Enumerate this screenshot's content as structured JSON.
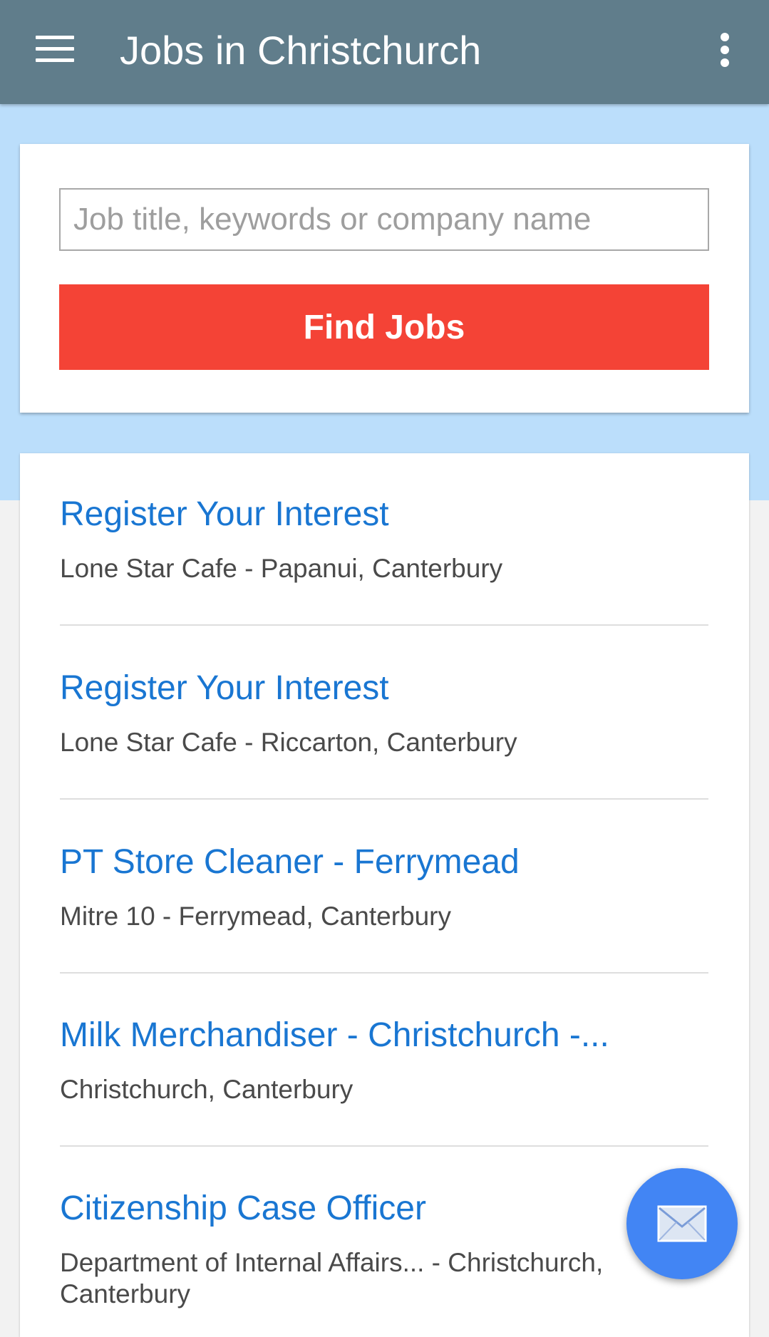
{
  "app_bar": {
    "title": "Jobs in Christchurch",
    "menu_icon": "hamburger-menu-icon",
    "overflow_icon": "more-vert-icon"
  },
  "search": {
    "placeholder": "Job title, keywords or company name",
    "value": "",
    "button_label": "Find Jobs"
  },
  "jobs": [
    {
      "title": "Register Your Interest",
      "meta": "Lone Star Cafe - Papanui, Canterbury"
    },
    {
      "title": "Register Your Interest",
      "meta": "Lone Star Cafe - Riccarton, Canterbury"
    },
    {
      "title": "PT Store Cleaner - Ferrymead",
      "meta": "Mitre 10 - Ferrymead, Canterbury"
    },
    {
      "title": "Milk Merchandiser - Christchurch -...",
      "meta": "Christchurch, Canterbury"
    },
    {
      "title": "Citizenship Case Officer",
      "meta": "Department of Internal Affairs... - Christchurch, Canterbury"
    }
  ],
  "fab": {
    "icon": "email-icon"
  },
  "colors": {
    "app_bar": "#607d8b",
    "hero": "#bbdefb",
    "accent_button": "#f44336",
    "link": "#1976d2",
    "fab": "#4285f4"
  }
}
